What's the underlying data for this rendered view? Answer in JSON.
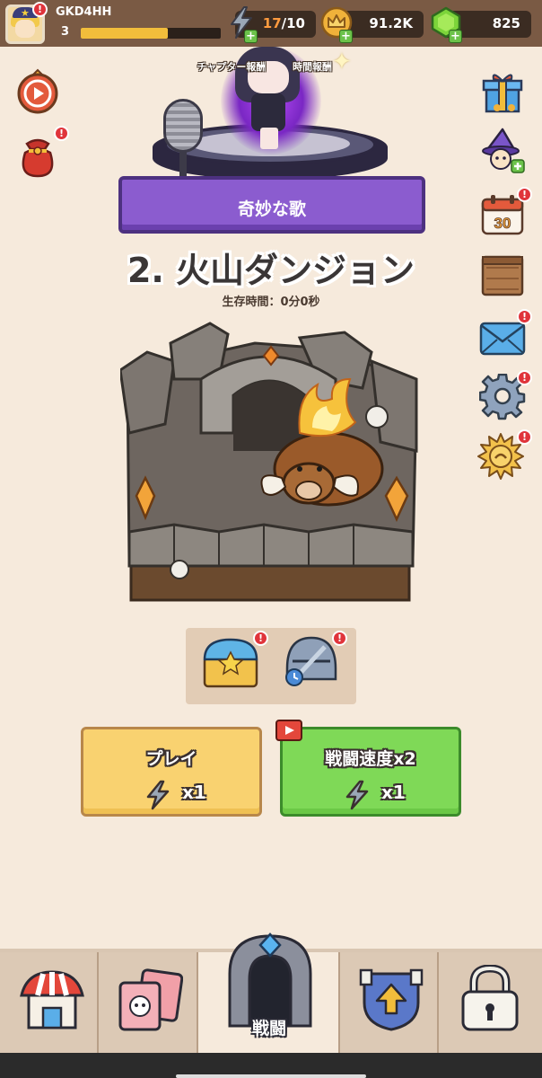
{
  "player": {
    "name": "GKD4HH",
    "level": "3",
    "xp_progress": 0.62
  },
  "resources": {
    "energy_current": "17",
    "energy_max": "/10",
    "coins": "91.2K",
    "gems": "825"
  },
  "stage": {
    "banner_text": "奇妙な歌"
  },
  "chapter": {
    "title": "2. 火山ダンジョン",
    "survival_time": "生存時間：0分0秒"
  },
  "rewards": {
    "chapter_reward_label": "チャプター報酬",
    "time_reward_label": "時間報酬"
  },
  "buttons": {
    "play_label": "プレイ",
    "play_cost": "x1",
    "speed_label": "戦闘速度x2",
    "speed_cost": "x1"
  },
  "side_icons": {
    "calendar_day": "30"
  },
  "badges": {
    "mark": "!"
  },
  "nav": {
    "active_label": "戦闘"
  },
  "colors": {
    "background": "#f6eadc",
    "topbar": "#7a5a44",
    "banner_purple": "#8b5ccf",
    "play_yellow": "#f9d270",
    "speed_green": "#7fd957",
    "badge_red": "#e0343b"
  }
}
